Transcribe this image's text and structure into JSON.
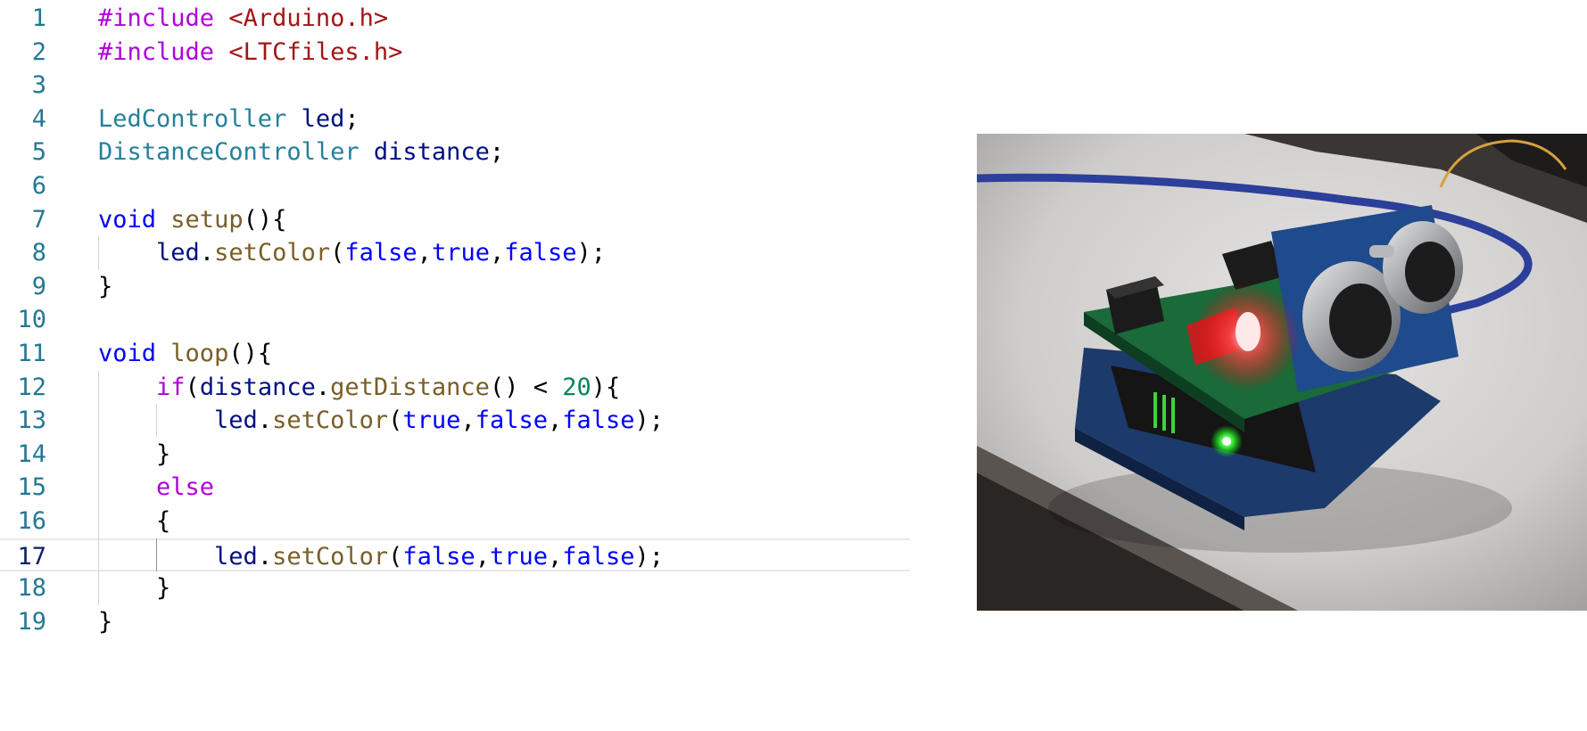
{
  "editor": {
    "lines": [
      {
        "num": "1",
        "tokens": [
          {
            "t": "#include",
            "c": "pp"
          },
          {
            "t": " ",
            "c": "p"
          },
          {
            "t": "<Arduino.h>",
            "c": "inc"
          }
        ]
      },
      {
        "num": "2",
        "tokens": [
          {
            "t": "#include",
            "c": "pp"
          },
          {
            "t": " ",
            "c": "p"
          },
          {
            "t": "<LTCfiles.h>",
            "c": "inc"
          }
        ]
      },
      {
        "num": "3",
        "tokens": []
      },
      {
        "num": "4",
        "tokens": [
          {
            "t": "LedController",
            "c": "type"
          },
          {
            "t": " ",
            "c": "p"
          },
          {
            "t": "led",
            "c": "var"
          },
          {
            "t": ";",
            "c": "p"
          }
        ]
      },
      {
        "num": "5",
        "tokens": [
          {
            "t": "DistanceController",
            "c": "type"
          },
          {
            "t": " ",
            "c": "p"
          },
          {
            "t": "distance",
            "c": "var"
          },
          {
            "t": ";",
            "c": "p"
          }
        ]
      },
      {
        "num": "6",
        "tokens": []
      },
      {
        "num": "7",
        "tokens": [
          {
            "t": "void",
            "c": "kw"
          },
          {
            "t": " ",
            "c": "p"
          },
          {
            "t": "setup",
            "c": "fn"
          },
          {
            "t": "(){",
            "c": "p"
          }
        ]
      },
      {
        "num": "8",
        "tokens": [
          {
            "t": "    ",
            "c": "p"
          },
          {
            "t": "led",
            "c": "var"
          },
          {
            "t": ".",
            "c": "p"
          },
          {
            "t": "setColor",
            "c": "fn"
          },
          {
            "t": "(",
            "c": "p"
          },
          {
            "t": "false",
            "c": "kw"
          },
          {
            "t": ",",
            "c": "p"
          },
          {
            "t": "true",
            "c": "kw"
          },
          {
            "t": ",",
            "c": "p"
          },
          {
            "t": "false",
            "c": "kw"
          },
          {
            "t": ");",
            "c": "p"
          }
        ]
      },
      {
        "num": "9",
        "tokens": [
          {
            "t": "}",
            "c": "p"
          }
        ]
      },
      {
        "num": "10",
        "tokens": []
      },
      {
        "num": "11",
        "tokens": [
          {
            "t": "void",
            "c": "kw"
          },
          {
            "t": " ",
            "c": "p"
          },
          {
            "t": "loop",
            "c": "fn"
          },
          {
            "t": "(){",
            "c": "p"
          }
        ]
      },
      {
        "num": "12",
        "tokens": [
          {
            "t": "    ",
            "c": "p"
          },
          {
            "t": "if",
            "c": "ctrl"
          },
          {
            "t": "(",
            "c": "p"
          },
          {
            "t": "distance",
            "c": "var"
          },
          {
            "t": ".",
            "c": "p"
          },
          {
            "t": "getDistance",
            "c": "fn"
          },
          {
            "t": "() < ",
            "c": "p"
          },
          {
            "t": "20",
            "c": "num"
          },
          {
            "t": "){",
            "c": "p"
          }
        ]
      },
      {
        "num": "13",
        "tokens": [
          {
            "t": "        ",
            "c": "p"
          },
          {
            "t": "led",
            "c": "var"
          },
          {
            "t": ".",
            "c": "p"
          },
          {
            "t": "setColor",
            "c": "fn"
          },
          {
            "t": "(",
            "c": "p"
          },
          {
            "t": "true",
            "c": "kw"
          },
          {
            "t": ",",
            "c": "p"
          },
          {
            "t": "false",
            "c": "kw"
          },
          {
            "t": ",",
            "c": "p"
          },
          {
            "t": "false",
            "c": "kw"
          },
          {
            "t": ");",
            "c": "p"
          }
        ]
      },
      {
        "num": "14",
        "tokens": [
          {
            "t": "    ",
            "c": "p"
          },
          {
            "t": "}",
            "c": "p"
          }
        ]
      },
      {
        "num": "15",
        "tokens": [
          {
            "t": "    ",
            "c": "p"
          },
          {
            "t": "else",
            "c": "ctrl"
          }
        ]
      },
      {
        "num": "16",
        "tokens": [
          {
            "t": "    ",
            "c": "p"
          },
          {
            "t": "{",
            "c": "p"
          }
        ]
      },
      {
        "num": "17",
        "tokens": [
          {
            "t": "        ",
            "c": "p"
          },
          {
            "t": "led",
            "c": "var"
          },
          {
            "t": ".",
            "c": "p"
          },
          {
            "t": "setColor",
            "c": "fn"
          },
          {
            "t": "(",
            "c": "p"
          },
          {
            "t": "false",
            "c": "kw"
          },
          {
            "t": ",",
            "c": "p"
          },
          {
            "t": "true",
            "c": "kw"
          },
          {
            "t": ",",
            "c": "p"
          },
          {
            "t": "false",
            "c": "kw"
          },
          {
            "t": ");",
            "c": "p"
          }
        ],
        "current": true
      },
      {
        "num": "18",
        "tokens": [
          {
            "t": "    ",
            "c": "p"
          },
          {
            "t": "}",
            "c": "p"
          }
        ]
      },
      {
        "num": "19",
        "tokens": [
          {
            "t": "}",
            "c": "p"
          }
        ]
      }
    ]
  },
  "photo": {
    "subject": "arduino-board-with-ultrasonic-sensor-and-red-led"
  },
  "colors": {
    "keyword": "#0000ff",
    "control": "#af00db",
    "include": "#a31515",
    "type": "#267f99",
    "variable": "#001080",
    "function": "#795e26",
    "number": "#098658",
    "line_number": "#237893",
    "active_line_number": "#0b216f"
  }
}
